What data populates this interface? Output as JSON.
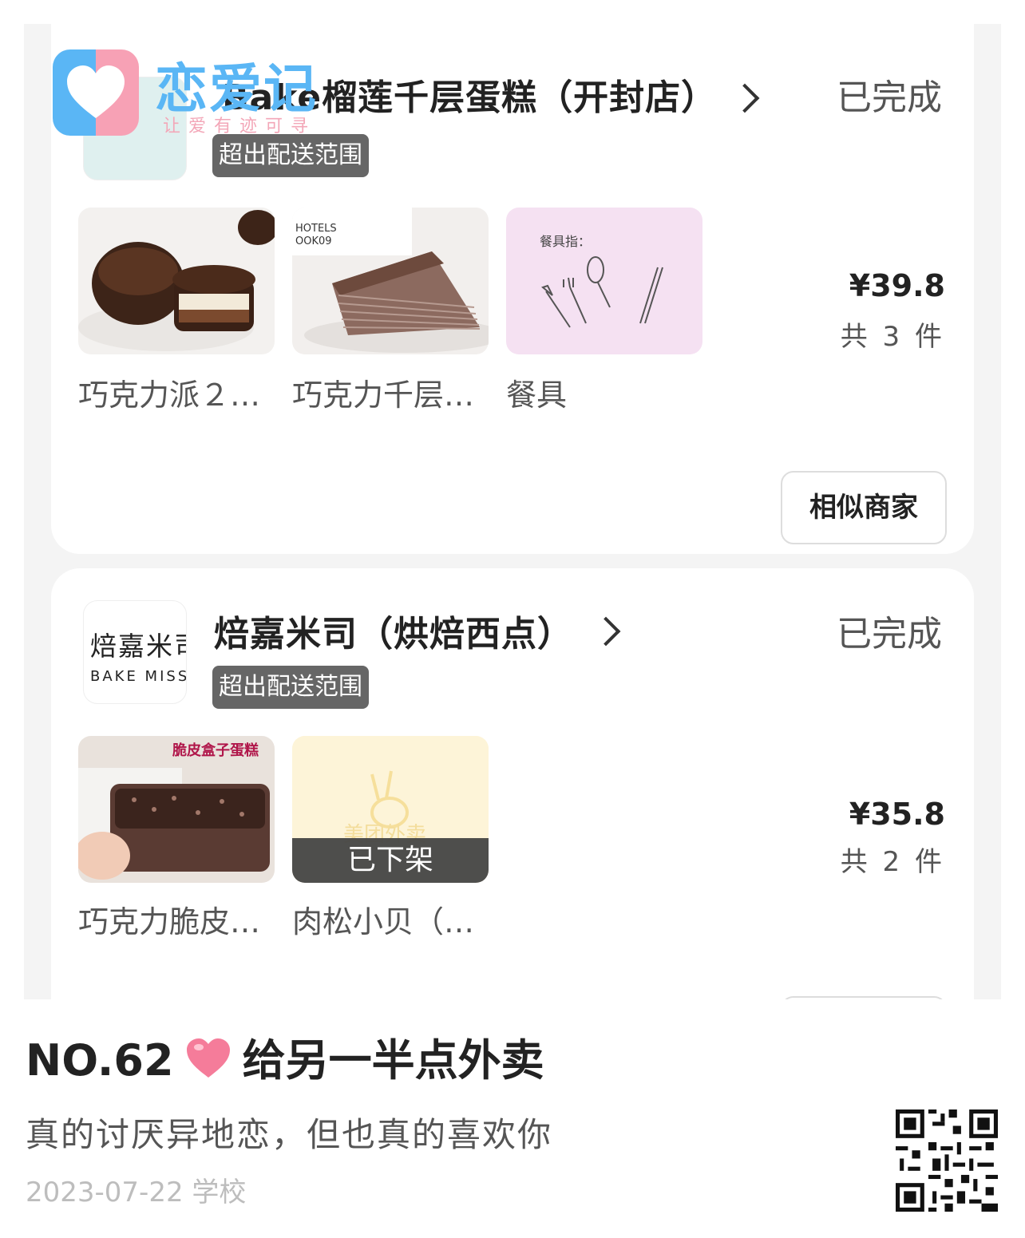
{
  "watermark": {
    "app_name": "恋爱记",
    "tagline": "让爱有迹可寻"
  },
  "orders": [
    {
      "shop_name": "Bake榴莲千层蛋糕（开封店）",
      "status": "已完成",
      "badge": "超出配送范围",
      "products": [
        {
          "name": "巧克力派２…",
          "icon": "chocolate-pie-photo"
        },
        {
          "name": "巧克力千层…",
          "icon": "crepe-cake-photo",
          "image_text": "HOTELS\nOOK09"
        },
        {
          "name": "餐具",
          "icon": "cutlery-photo",
          "image_text": "餐具指："
        }
      ],
      "price": "¥39.8",
      "count": "共 3 件",
      "action": "相似商家"
    },
    {
      "shop_name": "焙嘉米司（烘焙西点）",
      "logo_cn": "焙嘉米司",
      "logo_en": "BAKE MISS",
      "status": "已完成",
      "badge": "超出配送范围",
      "products": [
        {
          "name": "巧克力脆皮…",
          "icon": "box-cake-photo",
          "image_text": "脆皮盒子蛋糕"
        },
        {
          "name": "肉松小贝（…",
          "icon": "placeholder-photo",
          "overlay": "已下架",
          "image_text": "美团外卖"
        }
      ],
      "price": "¥35.8",
      "count": "共 2 件"
    }
  ],
  "post": {
    "number": "NO.62",
    "title": "给另一半点外卖",
    "text": "真的讨厌异地恋，但也真的喜欢你",
    "date_location": "2023-07-22 学校"
  },
  "colors": {
    "accent_blue": "#5ab6f5",
    "accent_pink": "#f7a1b5",
    "heart": "#f57c9a"
  }
}
